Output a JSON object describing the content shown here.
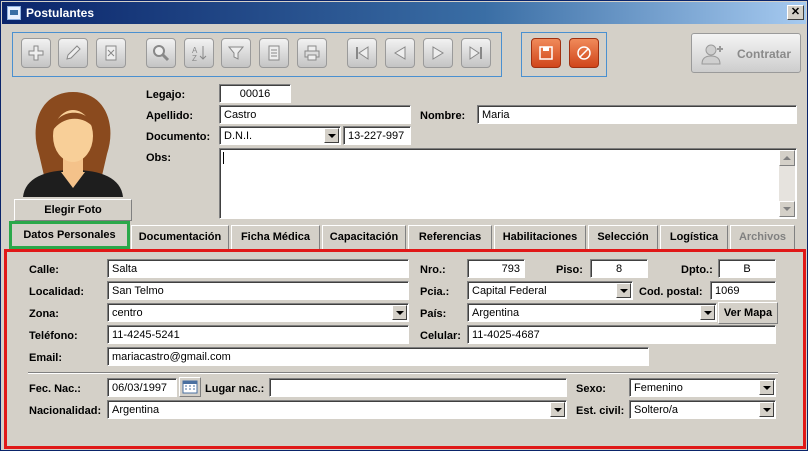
{
  "window": {
    "title": "Postulantes",
    "close_label": "✕"
  },
  "toolbar": {
    "buttons": [
      {
        "name": "add-icon"
      },
      {
        "name": "edit-icon"
      },
      {
        "name": "delete-icon"
      },
      {
        "name": "search-icon"
      },
      {
        "name": "sort-icon"
      },
      {
        "name": "filter-icon"
      },
      {
        "name": "report-icon"
      },
      {
        "name": "print-icon"
      },
      {
        "name": "first-record-icon"
      },
      {
        "name": "previous-record-icon"
      },
      {
        "name": "next-record-icon"
      },
      {
        "name": "last-record-icon"
      }
    ],
    "save_icon": "save-icon",
    "cancel_icon": "cancel-icon",
    "contratar_label": "Contratar"
  },
  "photo": {
    "button_label": "Elegir Foto"
  },
  "header": {
    "legajo_label": "Legajo:",
    "legajo_value": "00016",
    "apellido_label": "Apellido:",
    "apellido_value": "Castro",
    "nombre_label": "Nombre:",
    "nombre_value": "Maria",
    "documento_label": "Documento:",
    "documento_type": "D.N.I.",
    "documento_number": "13-227-997",
    "obs_label": "Obs:",
    "obs_value": ""
  },
  "tabs": [
    {
      "label": "Datos Personales",
      "active": true
    },
    {
      "label": "Documentación"
    },
    {
      "label": "Ficha Médica"
    },
    {
      "label": "Capacitación"
    },
    {
      "label": "Referencias"
    },
    {
      "label": "Habilitaciones"
    },
    {
      "label": "Selección"
    },
    {
      "label": "Logística"
    },
    {
      "label": "Archivos",
      "disabled": true
    }
  ],
  "personal": {
    "calle_label": "Calle:",
    "calle_value": "Salta",
    "nro_label": "Nro.:",
    "nro_value": "793",
    "piso_label": "Piso:",
    "piso_value": "8",
    "dpto_label": "Dpto.:",
    "dpto_value": "B",
    "localidad_label": "Localidad:",
    "localidad_value": "San Telmo",
    "pcia_label": "Pcia.:",
    "pcia_value": "Capital Federal",
    "cp_label": "Cod. postal:",
    "cp_value": "1069",
    "zona_label": "Zona:",
    "zona_value": "centro",
    "pais_label": "País:",
    "pais_value": "Argentina",
    "vermapa_label": "Ver Mapa",
    "telefono_label": "Teléfono:",
    "telefono_value": "11-4245-5241",
    "celular_label": "Celular:",
    "celular_value": "11-4025-4687",
    "email_label": "Email:",
    "email_value": "mariacastro@gmail.com",
    "fecnac_label": "Fec. Nac.:",
    "fecnac_value": "06/03/1997",
    "lugarnac_label": "Lugar nac.:",
    "lugarnac_value": "",
    "sexo_label": "Sexo:",
    "sexo_value": "Femenino",
    "nacionalidad_label": "Nacionalidad:",
    "nacionalidad_value": "Argentina",
    "estcivil_label": "Est. civil:",
    "estcivil_value": "Soltero/a"
  },
  "colors": {
    "accent_blue": "#4a90d0",
    "active_tab_border": "#2aa84a",
    "panel_border": "#e01818",
    "save_orange": "#e0642a"
  }
}
